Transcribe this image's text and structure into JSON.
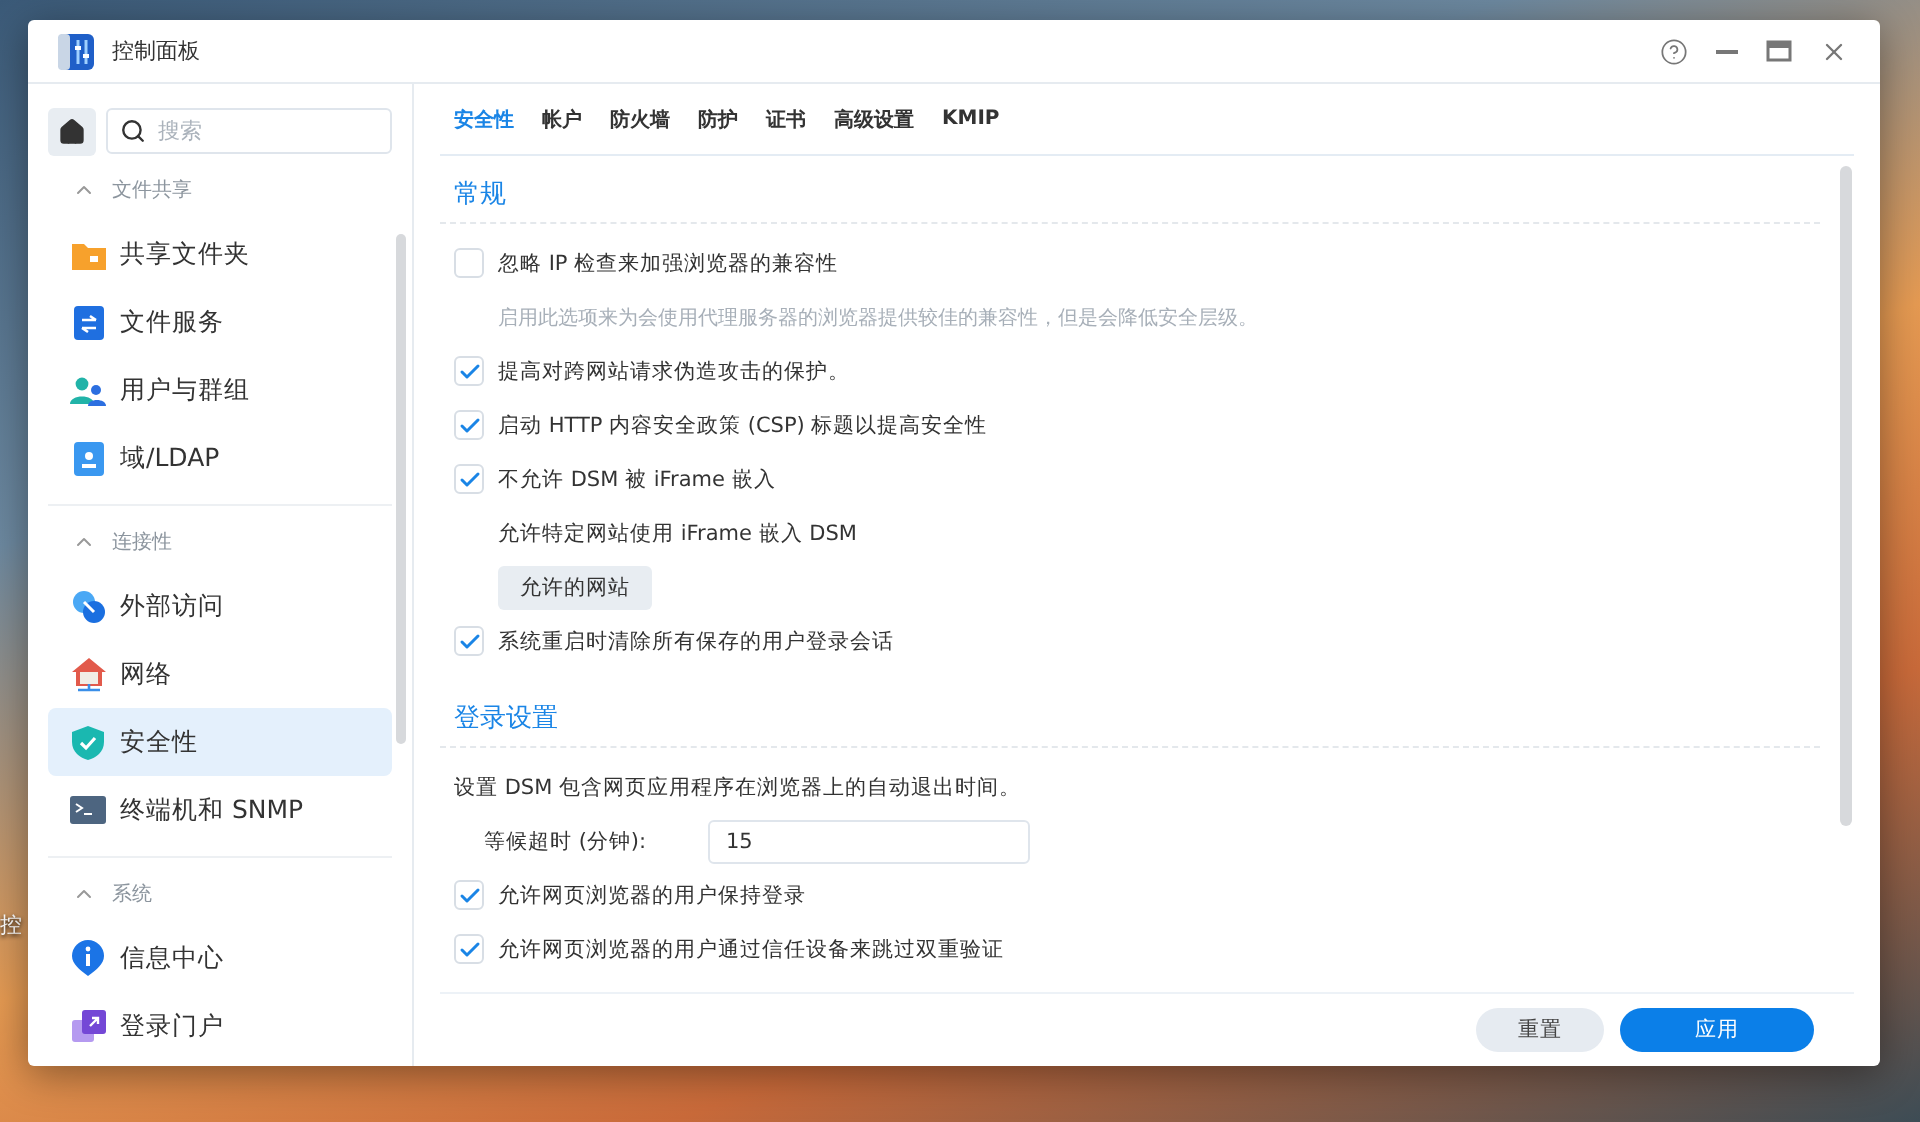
{
  "desktop": {
    "icon_label": "控"
  },
  "window": {
    "title": "控制面板"
  },
  "sidebar": {
    "search": {
      "placeholder": "搜索"
    },
    "groups": [
      {
        "title": "文件共享",
        "expanded": true,
        "items": [
          {
            "label": "共享文件夹",
            "selected": false
          },
          {
            "label": "文件服务",
            "selected": false
          },
          {
            "label": "用户与群组",
            "selected": false
          },
          {
            "label": "域/LDAP",
            "selected": false
          }
        ]
      },
      {
        "title": "连接性",
        "expanded": true,
        "items": [
          {
            "label": "外部访问",
            "selected": false
          },
          {
            "label": "网络",
            "selected": false
          },
          {
            "label": "安全性",
            "selected": true
          },
          {
            "label": "终端机和 SNMP",
            "selected": false
          }
        ]
      },
      {
        "title": "系统",
        "expanded": true,
        "items": [
          {
            "label": "信息中心",
            "selected": false
          },
          {
            "label": "登录门户",
            "selected": false
          }
        ]
      }
    ]
  },
  "tabs": [
    {
      "label": "安全性",
      "selected": true
    },
    {
      "label": "帐户",
      "selected": false
    },
    {
      "label": "防火墙",
      "selected": false
    },
    {
      "label": "防护",
      "selected": false
    },
    {
      "label": "证书",
      "selected": false
    },
    {
      "label": "高级设置",
      "selected": false
    },
    {
      "label": "KMIP",
      "selected": false
    }
  ],
  "sections": [
    {
      "title": "常规",
      "items": [
        {
          "kind": "checkbox",
          "label": "忽略 IP 检查来加强浏览器的兼容性",
          "checked": false
        },
        {
          "kind": "note",
          "label": "启用此选项来为会使用代理服务器的浏览器提供较佳的兼容性，但是会降低安全层级。"
        },
        {
          "kind": "checkbox",
          "label": "提高对跨网站请求伪造攻击的保护。",
          "checked": true
        },
        {
          "kind": "checkbox",
          "label": "启动 HTTP 内容安全政策 (CSP) 标题以提高安全性",
          "checked": true
        },
        {
          "kind": "checkbox",
          "label": "不允许 DSM 被 iFrame 嵌入",
          "checked": true
        },
        {
          "kind": "subtext",
          "label": "允许特定网站使用 iFrame 嵌入 DSM"
        },
        {
          "kind": "button",
          "label": "允许的网站"
        },
        {
          "kind": "checkbox",
          "label": "系统重启时清除所有保存的用户登录会话",
          "checked": true
        }
      ]
    },
    {
      "title": "登录设置",
      "items": [
        {
          "kind": "text",
          "label": "设置 DSM 包含网页应用程序在浏览器上的自动退出时间。"
        },
        {
          "kind": "field",
          "label": "等候超时 (分钟):",
          "value": "15"
        },
        {
          "kind": "checkbox",
          "label": "允许网页浏览器的用户保持登录",
          "checked": true
        },
        {
          "kind": "checkbox",
          "label": "允许网页浏览器的用户通过信任设备来跳过双重验证",
          "checked": true
        }
      ]
    }
  ],
  "footer": {
    "buttons": [
      {
        "label": "重置",
        "kind": "secondary"
      },
      {
        "label": "应用",
        "kind": "primary"
      }
    ]
  }
}
